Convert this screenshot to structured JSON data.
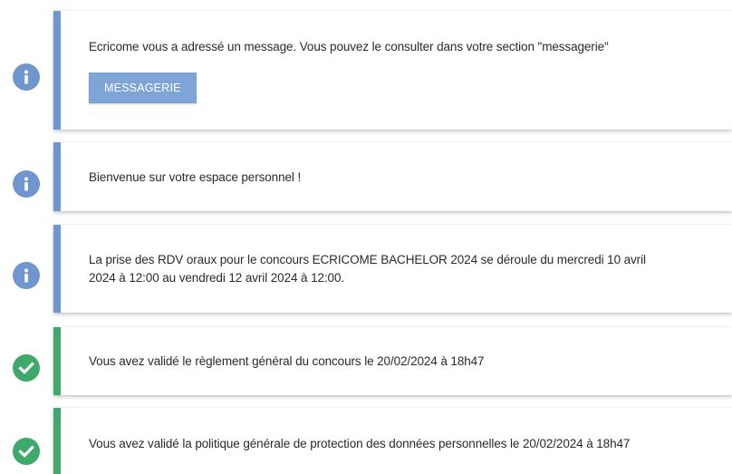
{
  "colors": {
    "info": "#6f96cf",
    "success": "#3fa86b"
  },
  "notifications": [
    {
      "type": "info",
      "icon": "info-icon",
      "text": "Ecricome vous a adressé un message. Vous pouvez le consulter dans votre section \"messagerie\"",
      "button_label": "MESSAGERIE"
    },
    {
      "type": "info",
      "icon": "info-icon",
      "text": "Bienvenue sur votre espace personnel !"
    },
    {
      "type": "info",
      "icon": "info-icon",
      "text_line1": "La prise des RDV oraux pour le concours ECRICOME BACHELOR 2024 se déroule du mercredi 10 avril",
      "text_line2": "2024 à 12:00 au vendredi 12 avril 2024 à 12:00."
    },
    {
      "type": "success",
      "icon": "check-circle-icon",
      "text": "Vous avez validé le règlement général du concours le 20/02/2024 à 18h47"
    },
    {
      "type": "success",
      "icon": "check-circle-icon",
      "text": "Vous avez validé la politique générale de protection des données personnelles le 20/02/2024 à 18h47"
    }
  ]
}
